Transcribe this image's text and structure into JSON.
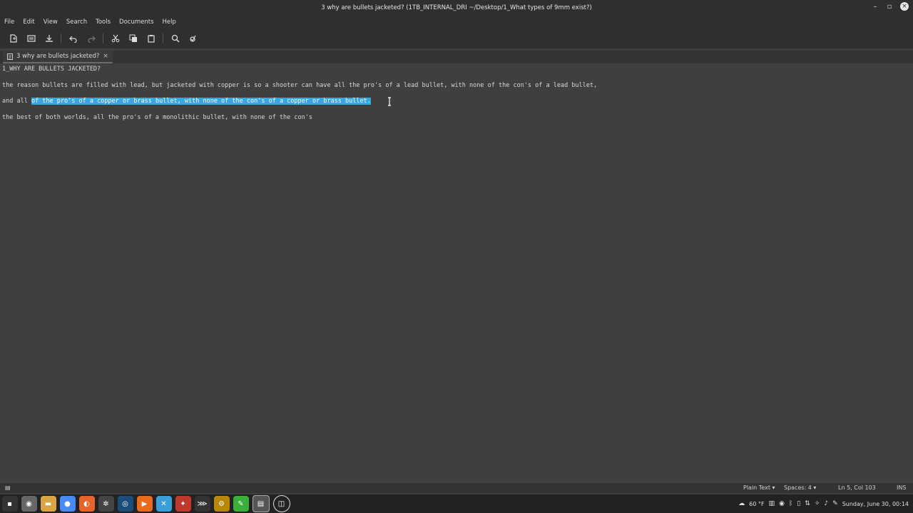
{
  "window": {
    "title": "3 why are bullets jacketed? (1TB_INTERNAL_DRI ~/Desktop/1_What types of 9mm exist?)"
  },
  "menu": [
    "File",
    "Edit",
    "View",
    "Search",
    "Tools",
    "Documents",
    "Help"
  ],
  "toolbar": {
    "icons": [
      "new-document-icon",
      "open-icon",
      "save-icon",
      "undo-icon",
      "redo-icon",
      "cut-icon",
      "copy-icon",
      "paste-icon",
      "find-icon",
      "find-replace-icon"
    ]
  },
  "tab": {
    "label": "3 why are bullets jacketed?",
    "close": "×"
  },
  "editor": {
    "lines": [
      "1_WHY ARE BULLETS JACKETED?",
      "the reason bullets are filled with lead, but jacketed with copper is so a shooter can have all the pro's of a lead bullet, with none of the con's of a lead bullet,",
      "and all ",
      "of the pro's of a copper or brass bullet, with none of the con's of a copper or brass bullet.",
      "the best of both worlds, all the pro's of a monolithic bullet, with none of the con's"
    ]
  },
  "status": {
    "language": "Plain Text",
    "spaces": "Spaces: 4",
    "position": "Ln 5, Col 103",
    "mode": "INS"
  },
  "taskbar": {
    "apps": [
      "menu-icon",
      "files-icon",
      "folder-icon",
      "chrome-icon",
      "firefox-icon",
      "settings-icon",
      "steam-icon",
      "media-player-icon",
      "vscode-icon",
      "game-icon",
      "terminal-icon",
      "system-icon",
      "green-app-icon",
      "text-editor-icon",
      "linux-app-icon"
    ],
    "weather": "60 °F",
    "clock": "Sunday, June 30, 00:14"
  },
  "colors": {
    "selection": "#37a7e0",
    "background": "#3f3f3f",
    "chrome": "#2f2f2f"
  }
}
